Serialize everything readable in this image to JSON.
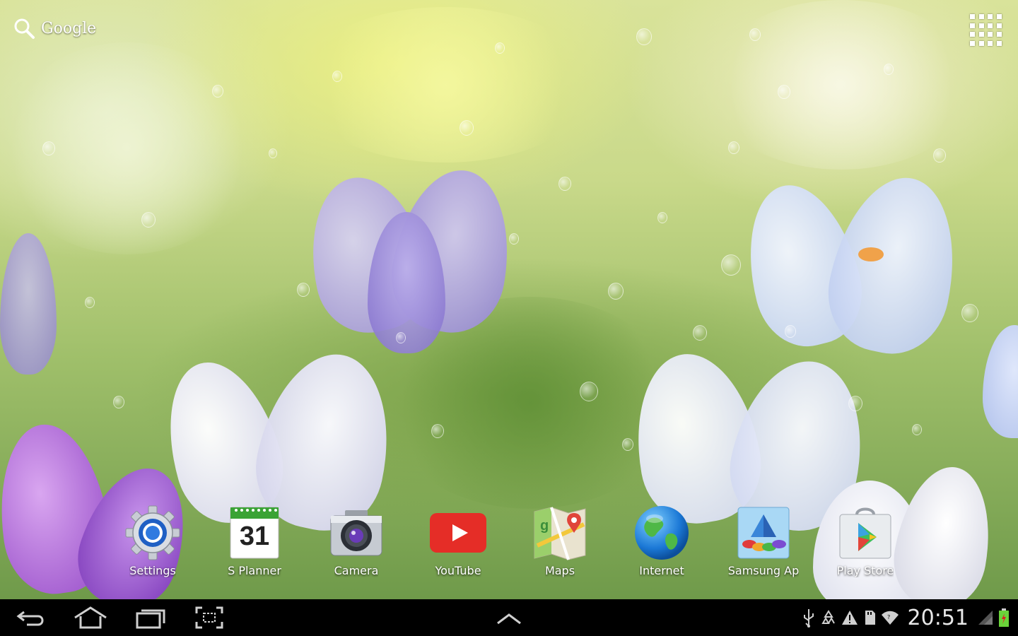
{
  "search": {
    "label": "Google"
  },
  "dock": {
    "items": [
      {
        "label": "Settings",
        "icon": "settings-icon"
      },
      {
        "label": "S Planner",
        "icon": "calendar-icon",
        "date": "31"
      },
      {
        "label": "Camera",
        "icon": "camera-icon"
      },
      {
        "label": "YouTube",
        "icon": "youtube-icon"
      },
      {
        "label": "Maps",
        "icon": "maps-icon"
      },
      {
        "label": "Internet",
        "icon": "globe-icon"
      },
      {
        "label": "Samsung Ap",
        "icon": "samsung-apps-icon"
      },
      {
        "label": "Play Store",
        "icon": "play-store-icon"
      }
    ]
  },
  "status_bar": {
    "time": "20:51"
  },
  "colors": {
    "navbar": "#000000",
    "youtube_red": "#e52d27",
    "battery_green": "#6ad33a"
  }
}
